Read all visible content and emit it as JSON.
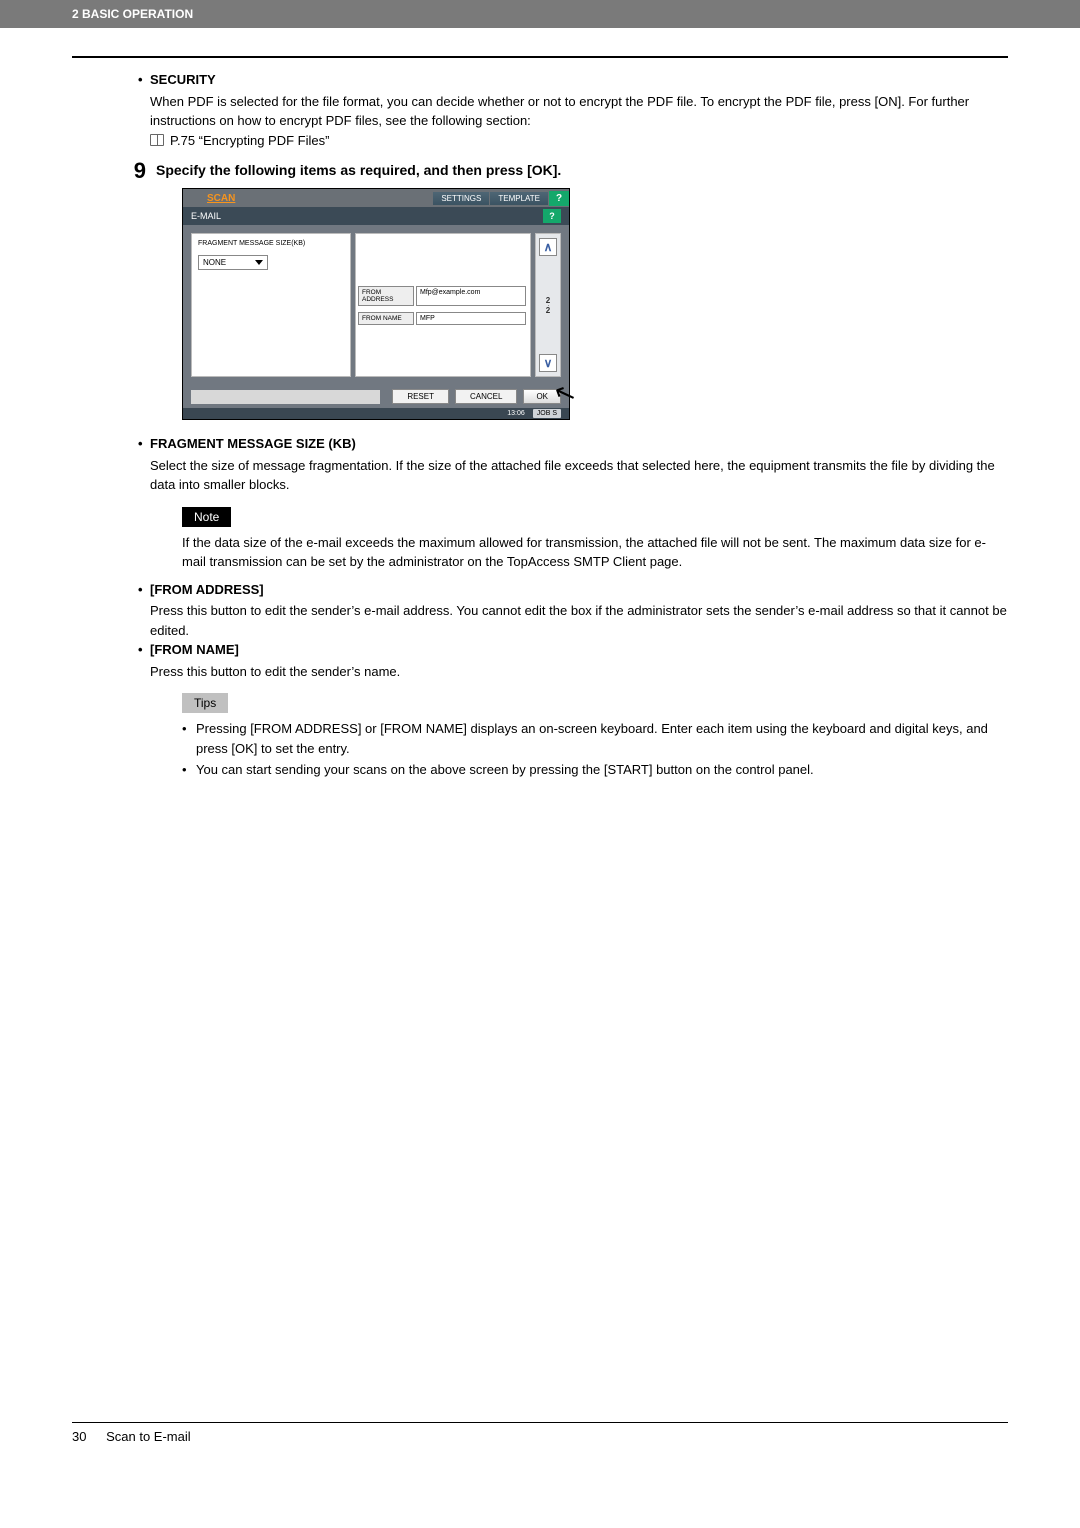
{
  "header": {
    "chapter": "2 BASIC OPERATION"
  },
  "security": {
    "title": "SECURITY",
    "body1": "When PDF is selected for the file format, you can decide whether or not to encrypt the PDF file. To encrypt the PDF file, press [ON]. For further instructions on how to encrypt PDF files, see the following section:",
    "link": "P.75 “Encrypting PDF Files”"
  },
  "step": {
    "num": "9",
    "text": "Specify the following items as required, and then press [OK]."
  },
  "scanpanel": {
    "title": "SCAN",
    "settings": "SETTINGS",
    "template": "TEMPLATE",
    "help1": "?",
    "subbar": "E-MAIL",
    "help2": "?",
    "frag_label": "FRAGMENT MESSAGE SIZE(KB)",
    "frag_value": "NONE",
    "from_addr_btn": "FROM ADDRESS",
    "from_addr_val": "Mfp@example.com",
    "from_name_btn": "FROM NAME",
    "from_name_val": "MFP",
    "arrow_up": "∧",
    "arrow_down": "∨",
    "page_cur": "2",
    "page_total": "2",
    "reset": "RESET",
    "cancel": "CANCEL",
    "ok": "OK",
    "time": "13:06",
    "jobs": "JOB S"
  },
  "fragment": {
    "title": "FRAGMENT MESSAGE SIZE (KB)",
    "body": "Select the size of message fragmentation. If the size of the attached file exceeds that selected here, the equipment transmits the file by dividing the data into smaller blocks."
  },
  "note": {
    "label": "Note",
    "body": "If the data size of the e-mail exceeds the maximum allowed for transmission, the attached file will not be sent. The maximum data size for e-mail transmission can be set by the administrator on the TopAccess SMTP Client page."
  },
  "from_addr": {
    "title": "[FROM ADDRESS]",
    "body": "Press this button to edit the sender’s e-mail address. You cannot edit the box if the administrator sets the sender’s e-mail address so that it cannot be edited."
  },
  "from_name": {
    "title": "[FROM NAME]",
    "body": "Press this button to edit the sender’s name."
  },
  "tips": {
    "label": "Tips",
    "item1": "Pressing [FROM ADDRESS] or [FROM NAME] displays an on-screen keyboard. Enter each item using the keyboard and digital keys, and press [OK] to set the entry.",
    "item2": "You can start sending your scans on the above screen by pressing the [START] button on the control panel."
  },
  "footer": {
    "page": "30",
    "section": "Scan to E-mail"
  }
}
